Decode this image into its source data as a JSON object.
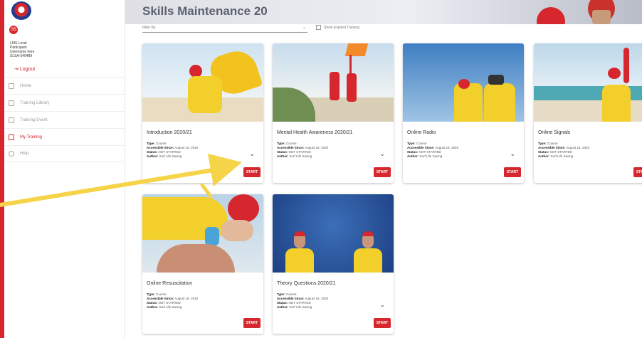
{
  "header": {
    "title": "Skills Maintenance 20"
  },
  "sidebar": {
    "avatar_initials": "SB",
    "user_lines": [
      "LMS Level",
      "Participant",
      "Username here",
      "SLSA-549489"
    ],
    "logout_label": "Logout",
    "items": [
      {
        "label": "Home",
        "icon": "home-icon",
        "active": false
      },
      {
        "label": "Training Library",
        "icon": "library-icon",
        "active": false
      },
      {
        "label": "Training Event",
        "icon": "calendar-icon",
        "active": false
      },
      {
        "label": "My Training",
        "icon": "training-icon",
        "active": true
      },
      {
        "label": "Help",
        "icon": "help-icon",
        "active": false
      }
    ]
  },
  "filters": {
    "filter_label": "Filter By",
    "show_expired_label": "Show Expired Training"
  },
  "meta_labels": {
    "type": "Type:",
    "accessible": "Accessible Since:",
    "status": "Status:",
    "author": "Author:"
  },
  "cards": [
    {
      "title": "Introduction 2020/21",
      "type": "Course",
      "accessible_since": "August 18, 2020",
      "status": "NOT STARTED",
      "author": "Surf Life Saving",
      "button": "START"
    },
    {
      "title": "Mental Health Awareness 2020/21",
      "type": "Course",
      "accessible_since": "August 18, 2020",
      "status": "NOT STARTED",
      "author": "Surf Life Saving",
      "button": "START"
    },
    {
      "title": "Online Radio",
      "type": "Course",
      "accessible_since": "August 18, 2020",
      "status": "NOT STARTED",
      "author": "Surf Life Saving",
      "button": "START"
    },
    {
      "title": "Online Signals",
      "type": "Course",
      "accessible_since": "August 18, 2020",
      "status": "NOT STARTED",
      "author": "Surf Life Saving",
      "button": "START"
    },
    {
      "title": "Online Resuscitation",
      "type": "Course",
      "accessible_since": "August 18, 2020",
      "status": "NOT STARTED",
      "author": "Surf Life Saving",
      "button": "START"
    },
    {
      "title": "Theory Questions 2020/21",
      "type": "Course",
      "accessible_since": "August 18, 2020",
      "status": "NOT STARTED",
      "author": "Surf Life Saving",
      "button": "START"
    }
  ],
  "colors": {
    "brand_red": "#d6262e",
    "brand_yellow": "#f2cf2a",
    "annotation_arrow": "#f6d44a"
  }
}
